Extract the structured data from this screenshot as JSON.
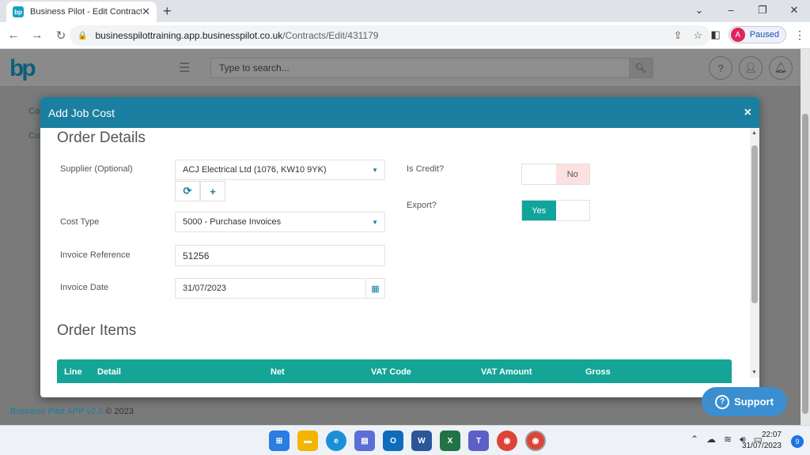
{
  "browser": {
    "tab_title": "Business Pilot - Edit Contract",
    "favicon_text": "bp",
    "url_host": "businesspilottraining.app.businesspilot.co.uk",
    "url_path": "/Contracts/Edit/431179",
    "profile_initial": "A",
    "profile_status": "Paused"
  },
  "app": {
    "logo": "bp",
    "search_placeholder": "Type to search...",
    "bg_label_1": "Co",
    "bg_label_2": "Cu",
    "footer_brand": "Business Pilot APP v2.0",
    "footer_copy": "© 2023"
  },
  "modal": {
    "title": "Add Job Cost",
    "order_details_title": "Order Details",
    "supplier_label": "Supplier (Optional)",
    "supplier_value": "ACJ Electrical Ltd (1076, KW10 9YK)",
    "cost_type_label": "Cost Type",
    "cost_type_value": "5000 - Purchase Invoices",
    "invoice_ref_label": "Invoice Reference",
    "invoice_ref_value": "51256",
    "invoice_date_label": "Invoice Date",
    "invoice_date_value": "31/07/2023",
    "is_credit_label": "Is Credit?",
    "is_credit_value": "No",
    "export_label": "Export?",
    "export_value": "Yes",
    "order_items_title": "Order Items",
    "columns": [
      "Line",
      "Detail",
      "Net",
      "VAT Code",
      "VAT Amount",
      "Gross"
    ]
  },
  "support": {
    "label": "Support"
  },
  "taskbar": {
    "time": "22:07",
    "date": "31/07/2023",
    "notifications": "9"
  }
}
